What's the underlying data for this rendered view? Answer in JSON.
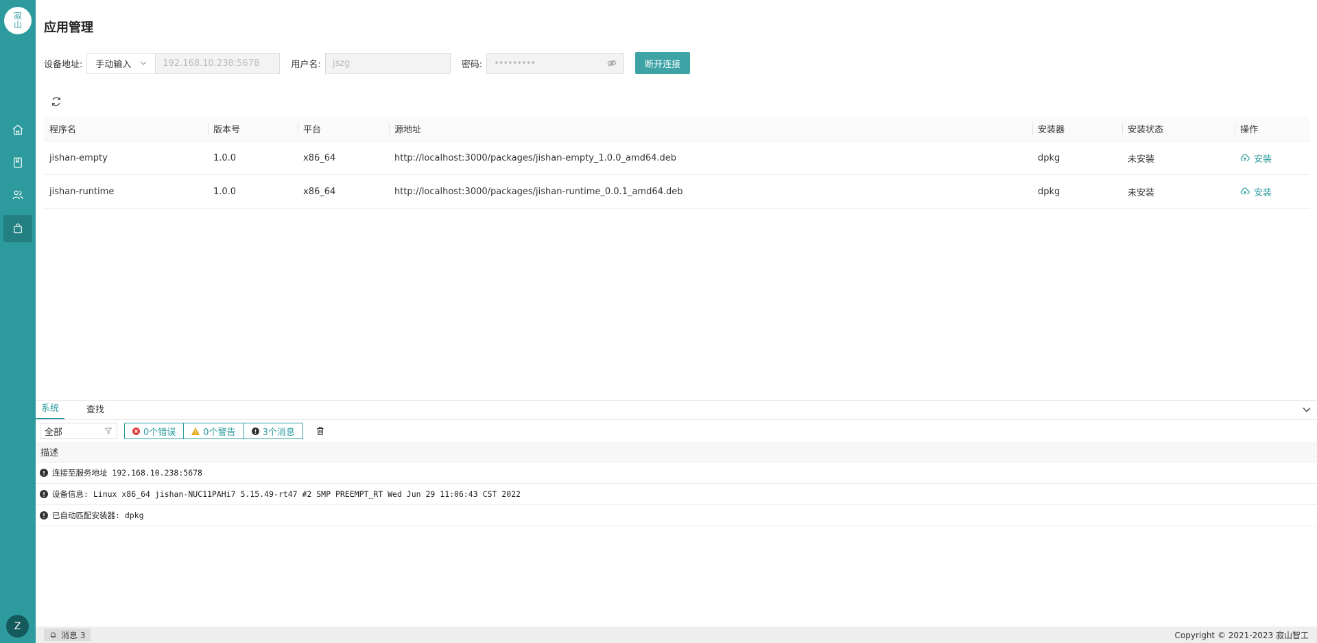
{
  "sidebar": {
    "logo_text": "寂山",
    "nav": [
      "home",
      "book",
      "users",
      "apps"
    ],
    "avatar_initial": "Z"
  },
  "page": {
    "title": "应用管理"
  },
  "connection": {
    "address_label": "设备地址:",
    "mode_value": "手动输入",
    "address_value": "192.168.10.238:5678",
    "username_label": "用户名:",
    "username_value": "jszg",
    "password_label": "密码:",
    "password_value": "•••••••••",
    "disconnect_label": "断开连接"
  },
  "table": {
    "headers": [
      "程序名",
      "版本号",
      "平台",
      "源地址",
      "安装器",
      "安装状态",
      "操作"
    ],
    "rows": [
      {
        "name": "jishan-empty",
        "version": "1.0.0",
        "platform": "x86_64",
        "source": "http://localhost:3000/packages/jishan-empty_1.0.0_amd64.deb",
        "installer": "dpkg",
        "status": "未安装",
        "action": "安装"
      },
      {
        "name": "jishan-runtime",
        "version": "1.0.0",
        "platform": "x86_64",
        "source": "http://localhost:3000/packages/jishan-runtime_0.0.1_amd64.deb",
        "installer": "dpkg",
        "status": "未安装",
        "action": "安装"
      }
    ]
  },
  "panel": {
    "tabs": [
      "系统",
      "查找"
    ],
    "filter_value": "全部",
    "errors_label": "0个错误",
    "warnings_label": "0个警告",
    "messages_label": "3个消息",
    "column_header": "描述",
    "logs": [
      "连接至服务地址 192.168.10.238:5678",
      "设备信息: Linux x86_64 jishan-NUC11PAHi7 5.15.49-rt47 #2 SMP PREEMPT_RT Wed Jun 29 11:06:43 CST 2022",
      "已自动匹配安装器: dpkg"
    ]
  },
  "statusbar": {
    "messages": "消息 3",
    "copyright": "Copyright © 2021-2023 寂山智工"
  },
  "colors": {
    "accent": "#2d9b9d",
    "sidebar": "#2d9b9d"
  }
}
